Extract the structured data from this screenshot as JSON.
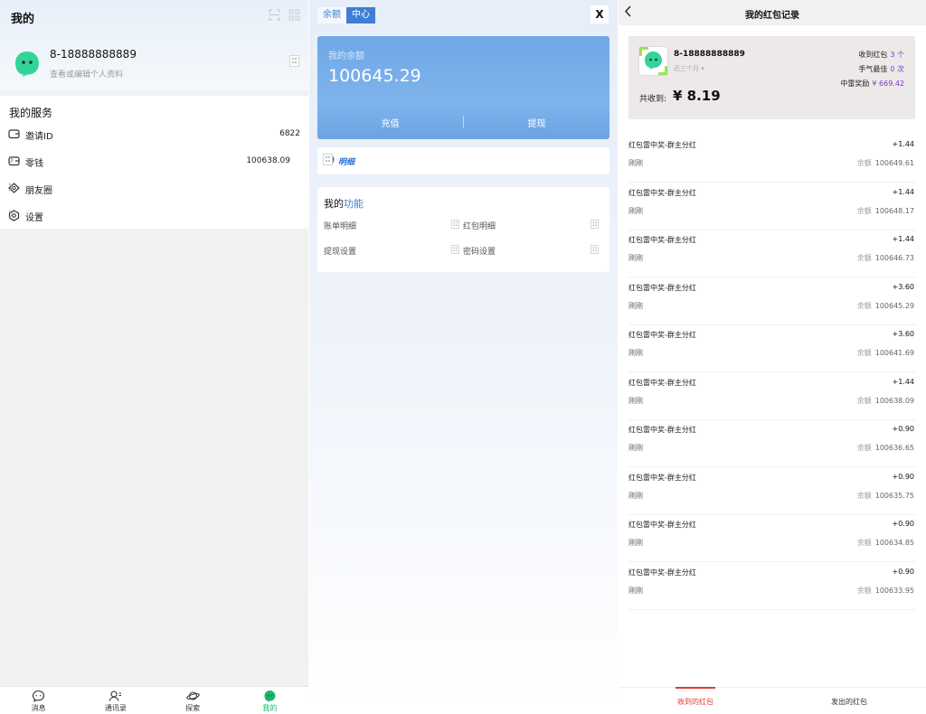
{
  "me": {
    "title": "我的",
    "profile": {
      "phone": "8-18888888889",
      "subtitle": "查看或编辑个人资料"
    },
    "services_title": "我的服务",
    "services": [
      {
        "label": "邀请ID",
        "value": "6822",
        "icon": "wallet-icon",
        "arrow": false
      },
      {
        "label": "零钱",
        "value": "100638.09",
        "icon": "wallet-icon",
        "arrow": true
      },
      {
        "label": "朋友圈",
        "value": "",
        "icon": "diamond-icon",
        "arrow": true
      },
      {
        "label": "设置",
        "value": "",
        "icon": "settings-icon",
        "arrow": true
      }
    ],
    "tabs": [
      {
        "label": "消息",
        "icon": "chat-icon",
        "active": false
      },
      {
        "label": "通讯录",
        "icon": "contacts-icon",
        "active": false
      },
      {
        "label": "探索",
        "icon": "planet-icon",
        "active": false
      },
      {
        "label": "我的",
        "icon": "avatar-icon",
        "active": true
      }
    ],
    "accent_color": "#1bb66a"
  },
  "balance_center": {
    "tab_left": "余额",
    "tab_right": "中心",
    "close_label": "X",
    "card": {
      "label": "我的余额",
      "amount": "100645.29",
      "recharge": "充值",
      "withdraw": "提现"
    },
    "detail_label": "明细",
    "functions_title_prefix": "我的",
    "functions_title_accent": "功能",
    "functions": [
      {
        "label": "账单明细"
      },
      {
        "label": "红包明细"
      },
      {
        "label": "提现设置"
      },
      {
        "label": "密码设置"
      }
    ],
    "accent_color": "#3f7ed4"
  },
  "records": {
    "title": "我的红包记录",
    "summary": {
      "phone": "8-18888888889",
      "period": "近三个月",
      "total_label": "共收到:",
      "total": "¥ 8.19",
      "stats": [
        {
          "label": "收到红包",
          "value": "3 个"
        },
        {
          "label": "手气最佳",
          "value": "0 次"
        },
        {
          "label": "中雷奖励",
          "value": "¥ 669.42"
        }
      ]
    },
    "balance_label": "余额",
    "items": [
      {
        "title": "红包雷中奖-群主分红",
        "amount": "+1.44",
        "time": "刚刚",
        "balance": "100649.61"
      },
      {
        "title": "红包雷中奖-群主分红",
        "amount": "+1.44",
        "time": "刚刚",
        "balance": "100648.17"
      },
      {
        "title": "红包雷中奖-群主分红",
        "amount": "+1.44",
        "time": "刚刚",
        "balance": "100646.73"
      },
      {
        "title": "红包雷中奖-群主分红",
        "amount": "+3.60",
        "time": "刚刚",
        "balance": "100645.29"
      },
      {
        "title": "红包雷中奖-群主分红",
        "amount": "+3.60",
        "time": "刚刚",
        "balance": "100641.69"
      },
      {
        "title": "红包雷中奖-群主分红",
        "amount": "+1.44",
        "time": "刚刚",
        "balance": "100638.09"
      },
      {
        "title": "红包雷中奖-群主分红",
        "amount": "+0.90",
        "time": "刚刚",
        "balance": "100636.65"
      },
      {
        "title": "红包雷中奖-群主分红",
        "amount": "+0.90",
        "time": "刚刚",
        "balance": "100635.75"
      },
      {
        "title": "红包雷中奖-群主分红",
        "amount": "+0.90",
        "time": "刚刚",
        "balance": "100634.85"
      },
      {
        "title": "红包雷中奖-群主分红",
        "amount": "+0.90",
        "time": "刚刚",
        "balance": "100633.95"
      }
    ],
    "tabs": [
      {
        "label": "收到的红包",
        "active": true
      },
      {
        "label": "发出的红包",
        "active": false
      }
    ],
    "accent_color": "#e23a2e"
  }
}
